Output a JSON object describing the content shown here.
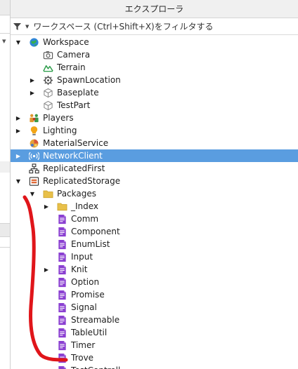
{
  "panel": {
    "title": "エクスプローラ"
  },
  "filter": {
    "placeholder": "ワークスペース (Ctrl+Shift+X)をフィルタする"
  },
  "tree": [
    {
      "label": "Workspace",
      "icon": "workspace-icon",
      "arrow": "expanded"
    },
    {
      "label": "Camera",
      "icon": "camera-icon",
      "arrow": "none"
    },
    {
      "label": "Terrain",
      "icon": "terrain-icon",
      "arrow": "none"
    },
    {
      "label": "SpawnLocation",
      "icon": "spawn-location-icon",
      "arrow": "collapsed"
    },
    {
      "label": "Baseplate",
      "icon": "part-icon",
      "arrow": "collapsed"
    },
    {
      "label": "TestPart",
      "icon": "part-icon",
      "arrow": "none"
    },
    {
      "label": "Players",
      "icon": "players-icon",
      "arrow": "collapsed"
    },
    {
      "label": "Lighting",
      "icon": "lighting-icon",
      "arrow": "collapsed"
    },
    {
      "label": "MaterialService",
      "icon": "material-service-icon",
      "arrow": "none"
    },
    {
      "label": "NetworkClient",
      "icon": "network-client-icon",
      "arrow": "collapsed",
      "selected": true
    },
    {
      "label": "ReplicatedFirst",
      "icon": "replicated-first-icon",
      "arrow": "none"
    },
    {
      "label": "ReplicatedStorage",
      "icon": "replicated-storage-icon",
      "arrow": "expanded"
    },
    {
      "label": "Packages",
      "icon": "folder-icon",
      "arrow": "expanded"
    },
    {
      "label": "_Index",
      "icon": "folder-icon",
      "arrow": "collapsed"
    },
    {
      "label": "Comm",
      "icon": "module-script-icon",
      "arrow": "none"
    },
    {
      "label": "Component",
      "icon": "module-script-icon",
      "arrow": "none"
    },
    {
      "label": "EnumList",
      "icon": "module-script-icon",
      "arrow": "none"
    },
    {
      "label": "Input",
      "icon": "module-script-icon",
      "arrow": "none"
    },
    {
      "label": "Knit",
      "icon": "module-script-icon",
      "arrow": "collapsed"
    },
    {
      "label": "Option",
      "icon": "module-script-icon",
      "arrow": "none"
    },
    {
      "label": "Promise",
      "icon": "module-script-icon",
      "arrow": "none"
    },
    {
      "label": "Signal",
      "icon": "module-script-icon",
      "arrow": "none"
    },
    {
      "label": "Streamable",
      "icon": "module-script-icon",
      "arrow": "none"
    },
    {
      "label": "TableUtil",
      "icon": "module-script-icon",
      "arrow": "none"
    },
    {
      "label": "Timer",
      "icon": "module-script-icon",
      "arrow": "none"
    },
    {
      "label": "Trove",
      "icon": "module-script-icon",
      "arrow": "none"
    },
    {
      "label": "TestControll",
      "icon": "module-script-icon",
      "arrow": "none"
    }
  ],
  "colors": {
    "selection": "#5a9de0",
    "annotation": "#e0151a",
    "module_script": "#8a3fd1",
    "folder": "#e8c04a"
  }
}
